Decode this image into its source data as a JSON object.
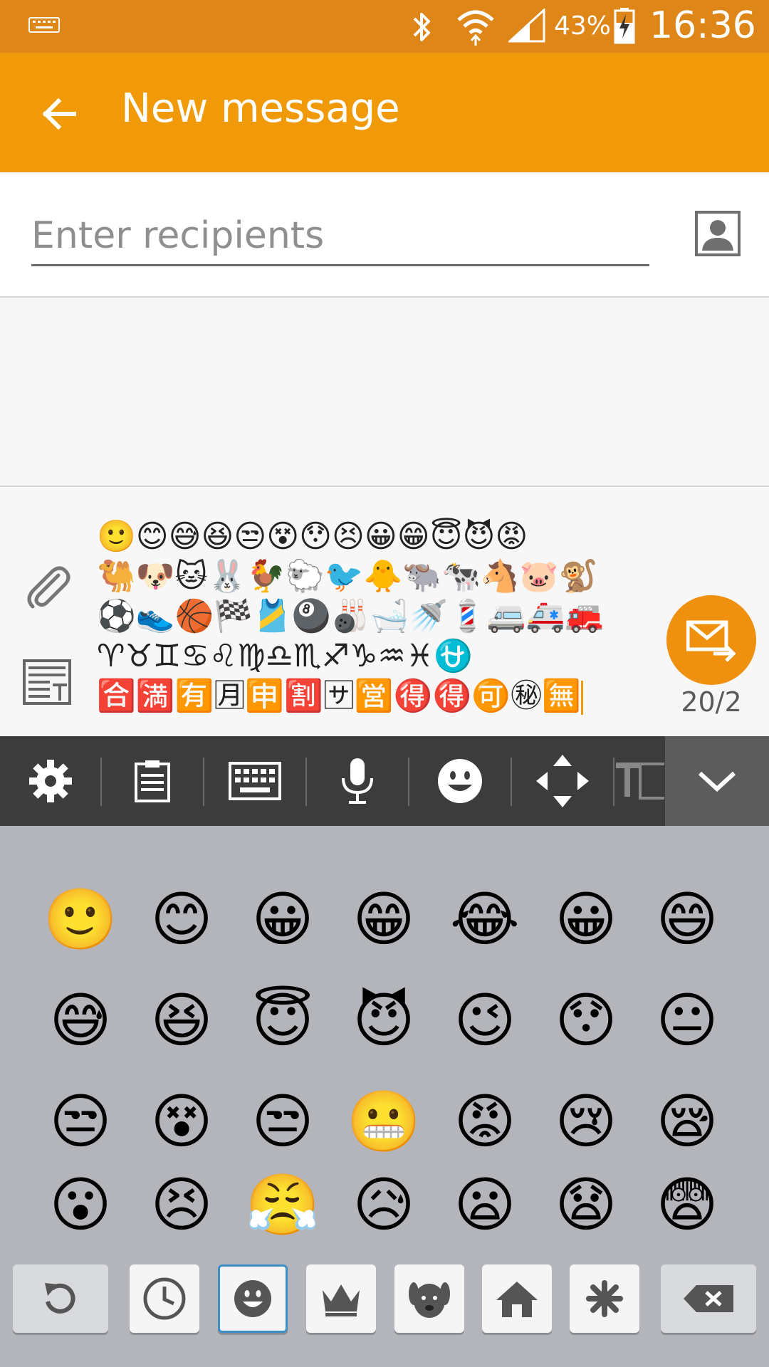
{
  "status_bar": {
    "battery": "43%",
    "time": "16:36",
    "icons": [
      "keyboard-icon",
      "bluetooth-icon",
      "wifi-icon",
      "signal-icon",
      "battery-charging-icon"
    ]
  },
  "app_bar": {
    "title": "New message",
    "back_icon": "arrow-left-icon"
  },
  "recipients": {
    "placeholder": "Enter recipients",
    "contact_icon": "contact-icon"
  },
  "composer": {
    "message_rows": [
      "🙂😊😅😆😒😵😯😣😀😁😇😈😡",
      "🐫🐶🐱🐰🐓🐑🐦🐥🐃🐄🐴🐷🐒",
      "⚽👟🏀🏁🎽🎱🎳🛁🚿💈🚐🚑🚒",
      "♈♉♊♋♌♍♎♏♐♑♒♓⛎",
      "🈴🈵🈶🈷🈸🈹🈂🈺🉐🉐🉑㊙🈚"
    ],
    "counter": "20/2",
    "send_icon": "send-mms-icon",
    "attach_icon": "paperclip-icon",
    "text_template_icon": "text-template-icon"
  },
  "keyboard_toolbar": {
    "items": [
      "gear-icon",
      "clipboard-icon",
      "keyboard-icon",
      "microphone-icon",
      "smiley-icon",
      "move-arrows-icon",
      "text-format-icon"
    ],
    "collapse_icon": "chevron-down-icon"
  },
  "emoji_grid": [
    "🙂",
    "😊",
    "😀",
    "😁",
    "😂",
    "😀",
    "😄",
    "😅",
    "😆",
    "😇",
    "😈",
    "😉",
    "😯",
    "😐",
    "😒",
    "😵",
    "😒",
    "😬",
    "😡",
    "😢",
    "😪",
    "😮",
    "😣",
    "😤",
    "😥",
    "😦",
    "😧",
    "😨"
  ],
  "category_bar": {
    "keys": [
      "undo-icon",
      "recent-clock-icon",
      "smiley-face-icon",
      "crown-icon",
      "dog-face-icon",
      "house-icon",
      "asterisk-symbol-icon",
      "backspace-icon"
    ],
    "active": "smiley-face-icon"
  },
  "colors": {
    "status_bar": "#df8618",
    "app_bar": "#f09a09",
    "send_button": "#f0900f",
    "toolbar": "#3c3c3c",
    "emoji_panel": "#b4b5ba"
  }
}
